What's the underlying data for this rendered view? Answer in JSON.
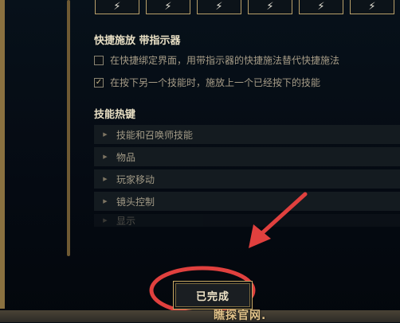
{
  "ability_slots": [
    "⚡",
    "⚡",
    "⚡",
    "⚡",
    "⚡",
    "⚡"
  ],
  "quickcast_section": {
    "title": "快捷施放 带指示器",
    "options": [
      {
        "label": "在快捷绑定界面，用带指示器的快捷施法替代快捷施法",
        "checked": false
      },
      {
        "label": "在按下另一个技能时，施放上一个已经按下的技能",
        "checked": true
      }
    ]
  },
  "hotkeys_section": {
    "title": "技能热键",
    "items": [
      "技能和召唤师技能",
      "物品",
      "玩家移动",
      "镜头控制",
      "显示"
    ]
  },
  "done_button": {
    "label": "已完成"
  },
  "watermark": {
    "text": "瞧探官网."
  },
  "colors": {
    "accent_gold": "#c9a963",
    "annotation_red": "#e0403e"
  }
}
